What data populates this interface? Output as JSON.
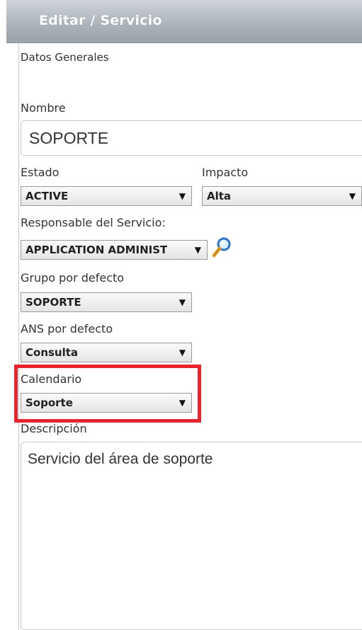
{
  "header": {
    "title": "Editar / Servicio"
  },
  "section": {
    "title": "Datos Generales"
  },
  "fields": {
    "nombre": {
      "label": "Nombre",
      "value": "SOPORTE"
    },
    "estado": {
      "label": "Estado",
      "value": "ACTIVE"
    },
    "impacto": {
      "label": "Impacto",
      "value": "Alta"
    },
    "responsable": {
      "label": "Responsable del Servicio:",
      "value": "APPLICATION ADMINIST"
    },
    "grupo": {
      "label": "Grupo por defecto",
      "value": "SOPORTE"
    },
    "ans": {
      "label": "ANS por defecto",
      "value": "Consulta"
    },
    "calendario": {
      "label": "Calendario",
      "value": "Soporte"
    },
    "descripcion": {
      "label": "Descripción",
      "value": "Servicio del área de soporte"
    }
  },
  "icons": {
    "dropdown": "▼",
    "lookup": "magnifier-icon"
  },
  "colors": {
    "highlight": "#e8242e",
    "titlebar": "#aeb5bb"
  }
}
